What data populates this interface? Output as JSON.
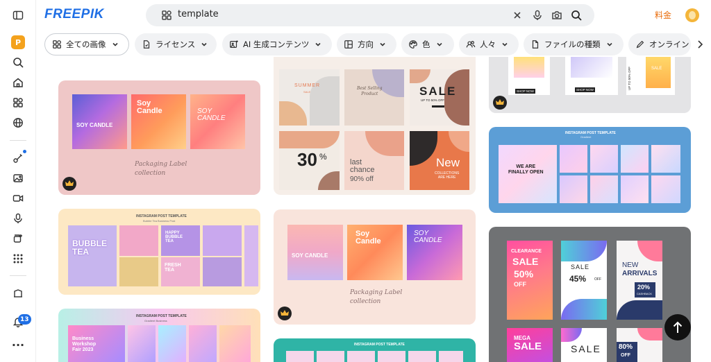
{
  "brand": {
    "logo": "FREEPIK"
  },
  "search": {
    "query": "template"
  },
  "header": {
    "pricing_label": "料金"
  },
  "sidebar": {
    "notification_count": "13"
  },
  "filters": [
    {
      "label": "全ての画像",
      "icon": "grid-icon"
    },
    {
      "label": "ライセンス",
      "icon": "file-icon"
    },
    {
      "label": "AI 生成コンテンツ",
      "icon": "ai-icon"
    },
    {
      "label": "方向",
      "icon": "layout-icon"
    },
    {
      "label": "色",
      "icon": "palette-icon"
    },
    {
      "label": "人々",
      "icon": "people-icon"
    },
    {
      "label": "ファイルの種類",
      "icon": "file-icon"
    },
    {
      "label": "オンライン",
      "icon": "pen-icon"
    }
  ],
  "cards": {
    "soy1": {
      "title1": "SOY CANDLE",
      "title2": "Soy\nCandle",
      "title3": "SOY\nCANDLE",
      "script": "Packaging Label\ncollection"
    },
    "summer": {
      "summer": "SUMMER",
      "sale_small": "SALE",
      "best": "Best Selling\nProduct",
      "sale": "SALE",
      "upto": "UP TO 50% OFF",
      "p30": "30",
      "pct": "%",
      "last": "last\nchance",
      "off": "90% off",
      "new": "New",
      "coll": "COLLECTIONS\nARE HERE"
    },
    "insta_bubble": {
      "header": "INSTAGRAM POST TEMPLATE",
      "sub": "Bubble Tea Business Post",
      "bubble": "BUBBLE\nTEA",
      "fresh": "FRESH\nTEA",
      "happy": "HAPPY\nBUBBLE\nTEA"
    },
    "soy2": {
      "title1": "SOY CANDLE",
      "title2": "Soy\nCandle",
      "title3": "SOY\nCANDLE",
      "script": "Packaging Label\ncollection"
    },
    "insta_grad_right": {
      "header": "INSTAGRAM POST TEMPLATE",
      "sub": "Gradient",
      "finally": "WE ARE\nFINALLY OPEN"
    },
    "stories": {
      "clearance": "CLEARANCE",
      "sale": "SALE",
      "p50": "50%",
      "off": "OFF",
      "sale2": "SALE",
      "p45": "45%",
      "off45": "OFF",
      "new": "NEW",
      "arrivals": "ARRIVALS",
      "p20": "20%",
      "cashback": "CASHBACK",
      "mega": "MEGA",
      "sale3": "SALE",
      "sale4": "SALE",
      "p80": "80%",
      "off80": "OFF"
    },
    "insta_grad_left": {
      "header": "INSTAGRAM POST TEMPLATE",
      "sub": "Gradient Business",
      "business": "Business\nWorkshop\nFair 2023"
    },
    "insta_teal": {
      "header": "INSTAGRAM POST TEMPLATE"
    },
    "top_right": {
      "shop": "SHOP NOW",
      "shop2": "SHOP NOW",
      "upto": "UP TO 50% OFF",
      "sale": "SALE"
    }
  },
  "colors": {
    "brand": "#1f6fe5",
    "pricing": "#e96d0c",
    "badge": "#1f6fe5"
  }
}
